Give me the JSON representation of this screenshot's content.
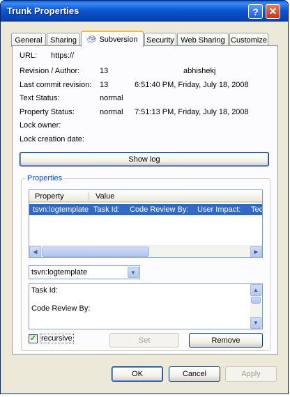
{
  "window": {
    "title": "Trunk Properties",
    "help_label": "?",
    "close_label": "✕"
  },
  "tabs": [
    {
      "label": "General"
    },
    {
      "label": "Sharing"
    },
    {
      "label": "Subversion",
      "icon": "tortoise-icon",
      "active": true
    },
    {
      "label": "Security"
    },
    {
      "label": "Web Sharing"
    },
    {
      "label": "Customize"
    }
  ],
  "info": {
    "url_label": "URL:",
    "url_value": "https://",
    "revision_label": "Revision / Author:",
    "revision_value": "13",
    "author_value": "abhishekj",
    "last_commit_label": "Last commit revision:",
    "last_commit_value": "13",
    "last_commit_date": "6:51:40 PM, Friday, July 18, 2008",
    "text_status_label": "Text Status:",
    "text_status_value": "normal",
    "property_status_label": "Property Status:",
    "property_status_value": "normal",
    "property_status_date": "7:51:13 PM, Friday, July 18, 2008",
    "lock_owner_label": "Lock owner:",
    "lock_date_label": "Lock creation date:"
  },
  "show_log_label": "Show log",
  "properties": {
    "group_label": "Properties",
    "columns": [
      "Property",
      "Value"
    ],
    "selected_row": {
      "property": "tsvn:logtemplate",
      "value_parts": [
        "Task Id:",
        "Code Review By:",
        "User Impact:",
        "Tec"
      ]
    },
    "combo_value": "tsvn:logtemplate",
    "text_lines": [
      "Task Id:",
      "Code Review By:"
    ],
    "recursive_label": "recursive",
    "recursive_checked": true,
    "set_label": "Set",
    "remove_label": "Remove"
  },
  "footer": {
    "ok_label": "OK",
    "cancel_label": "Cancel",
    "apply_label": "Apply"
  },
  "colors": {
    "selection": "#316ac5",
    "titlebar": "#0b57d0",
    "group_label": "#0046d5",
    "active_tab_accent": "#f5b73c"
  }
}
